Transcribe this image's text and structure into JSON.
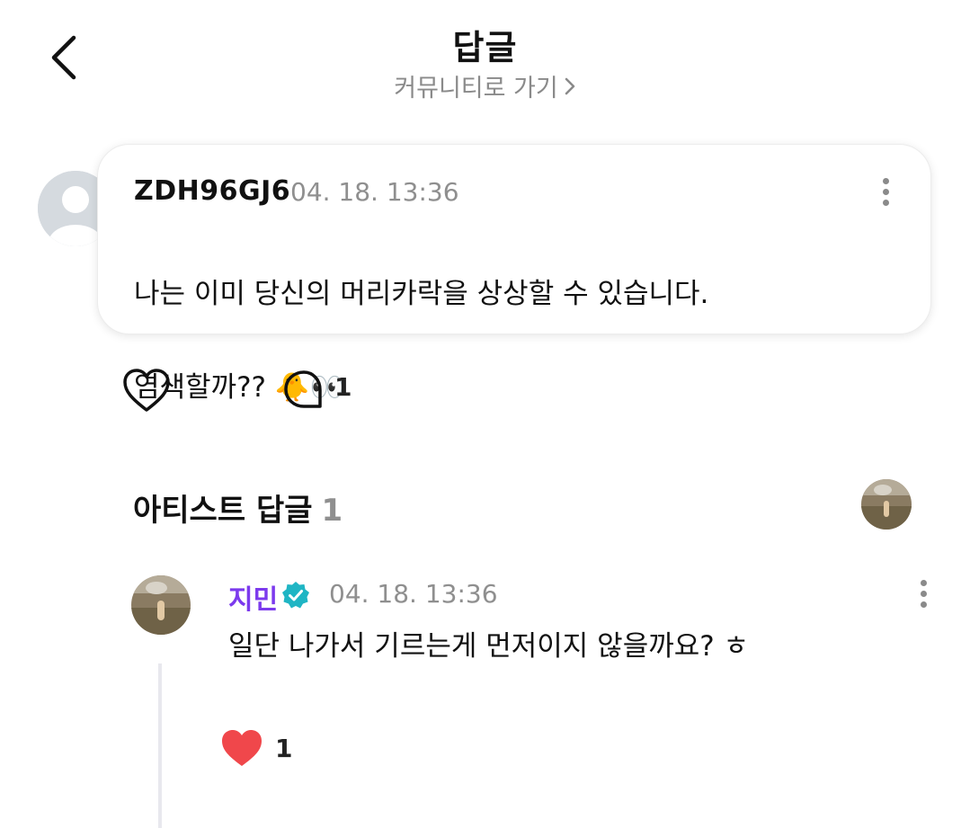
{
  "header": {
    "title": "답글",
    "community_link": "커뮤니티로 가기",
    "icons": {
      "back": "chevron-left-icon",
      "link": "chevron-right-icon"
    }
  },
  "post": {
    "author": "ZDH96GJ6",
    "timestamp": "04. 18. 13:36",
    "body_line1": "나는 이미 당신의 머리카락을 상상할 수 있습니다.",
    "body_line2": "염색할까?? 🐥👀",
    "reply_count": "1",
    "icons": {
      "avatar": "default-avatar-icon",
      "more": "kebab-icon",
      "like": "heart-outline-icon",
      "reply": "speech-bubble-icon"
    }
  },
  "artist_replies": {
    "title": "아티스트 답글",
    "count": "1",
    "icons": {
      "artist_avatar": "artist-photo-avatar"
    }
  },
  "reply": {
    "author": "지민",
    "timestamp": "04. 18. 13:36",
    "body": "일단 나가서 기르는게 먼저이지 않을까요? ㅎ",
    "like_count": "1",
    "author_color": "#7c3aed",
    "badge_color": "#1fb5c4",
    "like_color": "#f0474b",
    "icons": {
      "verified": "verified-badge-icon",
      "like": "heart-filled-icon",
      "more": "kebab-icon"
    }
  }
}
